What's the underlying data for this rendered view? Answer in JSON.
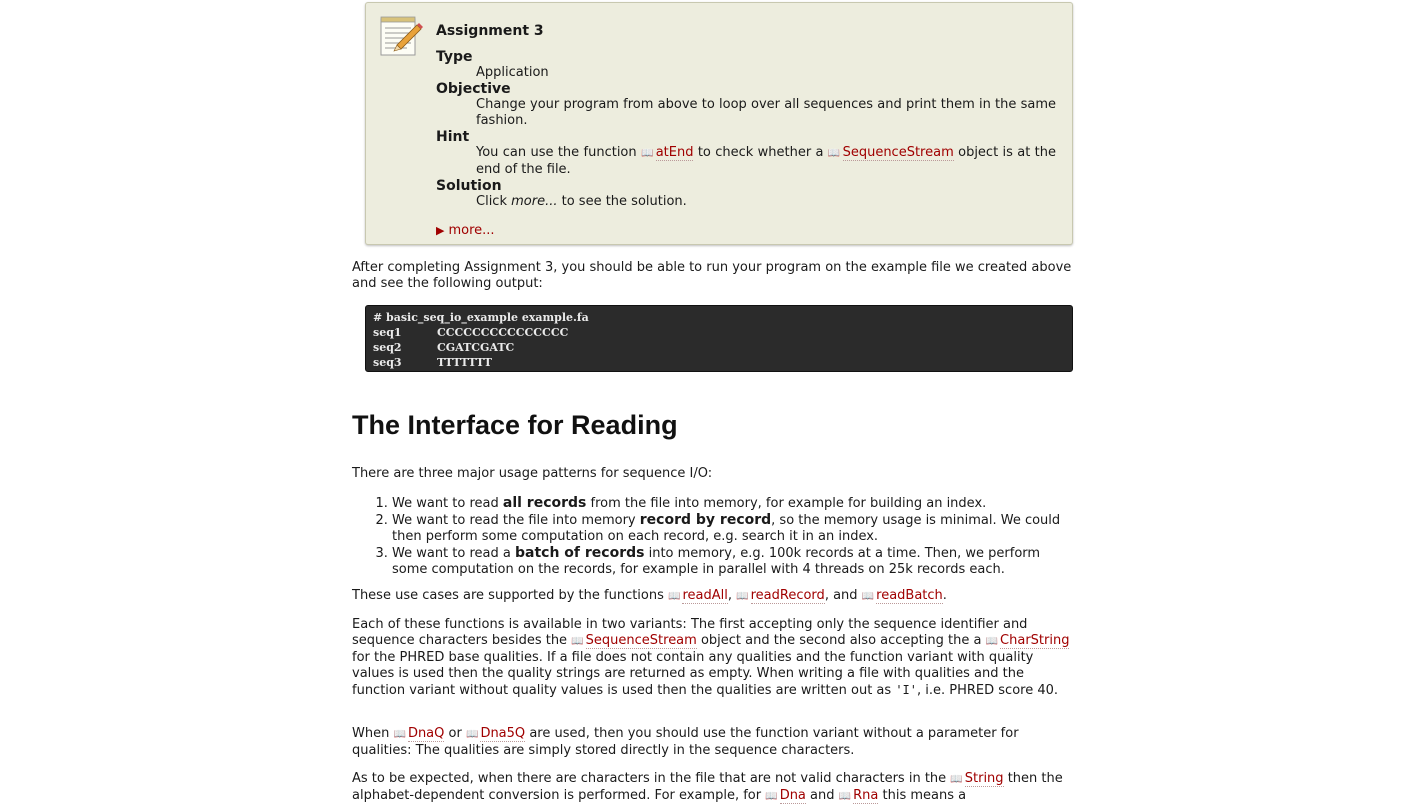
{
  "assignment": {
    "title": "Assignment 3",
    "type_label": "Type",
    "type_value": "Application",
    "objective_label": "Objective",
    "objective_text": "Change your program from above to loop over all sequences and print them in the same fashion.",
    "hint_label": "Hint",
    "hint_pre": "You can use the function",
    "hint_link1": "atEnd",
    "hint_mid": "to check whether a",
    "hint_link2": "SequenceStream",
    "hint_post": "object is at the end of the file.",
    "solution_label": "Solution",
    "solution_pre": "Click",
    "solution_em": "more...",
    "solution_post": "to see the solution.",
    "more_link": "more..."
  },
  "after_text": "After completing Assignment 3, you should be able to run your program on the example file we created above and see the following output:",
  "code": {
    "cmd": "# basic_seq_io_example example.fa",
    "rows": [
      {
        "name": "seq1",
        "seq": "CCCCCCCCCCCCCCC"
      },
      {
        "name": "seq2",
        "seq": "CGATCGATC"
      },
      {
        "name": "seq3",
        "seq": "TTTTTTT"
      }
    ]
  },
  "heading": "The Interface for Reading",
  "intro": "There are three major usage patterns for sequence I/O:",
  "list": [
    {
      "pre": "We want to read",
      "bold": "all records",
      "post": "from the file into memory, for example for building an index."
    },
    {
      "pre": "We want to read the file into memory",
      "bold": "record by record",
      "post": ", so the memory usage is minimal. We could then perform some computation on each record, e.g. search it in an index."
    },
    {
      "pre": "We want to read a",
      "bold": "batch of records",
      "post": "into memory, e.g. 100k records at a time. Then, we perform some computation on the records, for example in parallel with 4 threads on 25k records each."
    }
  ],
  "usecases": {
    "pre": "These use cases are supported by the functions",
    "f1": "readAll",
    "f2": "readRecord",
    "and": ", and",
    "f3": "readBatch"
  },
  "variants": {
    "t1": "Each of these functions is available in two variants: The first accepting only the sequence identifier and sequence characters besides the",
    "l1": "SequenceStream",
    "t2": "object and the second also accepting the a",
    "l2": "CharString",
    "t3": "for the PHRED base qualities. If a file does not contain any qualities and the function variant with quality values is used then the quality strings are returned as empty. When writing a file with qualities and the function variant without quality values is used then the qualities are written out as",
    "code": "'I'",
    "t4": ", i.e. PHRED score 40."
  },
  "dnaq": {
    "t1": "When",
    "l1": "DnaQ",
    "t2": "or",
    "l2": "Dna5Q",
    "t3": "are used, then you should use the function variant without a parameter for qualities: The qualities are simply stored directly in the sequence characters."
  },
  "expected": {
    "t1": "As to be expected, when there are characters in the file that are not valid characters in the",
    "l1": "String",
    "t2": "then the alphabet-dependent conversion is performed. For example, for",
    "l2": "Dna",
    "t3": "and",
    "l3": "Rna",
    "t4": "this means a"
  },
  "icons": {
    "book": "book-icon",
    "notepad": "notepad-pencil-icon",
    "triangle": "triangle-right-icon"
  },
  "colors": {
    "link": "#a00000",
    "box_bg": "#ededde",
    "code_bg": "#2b2b2b"
  }
}
